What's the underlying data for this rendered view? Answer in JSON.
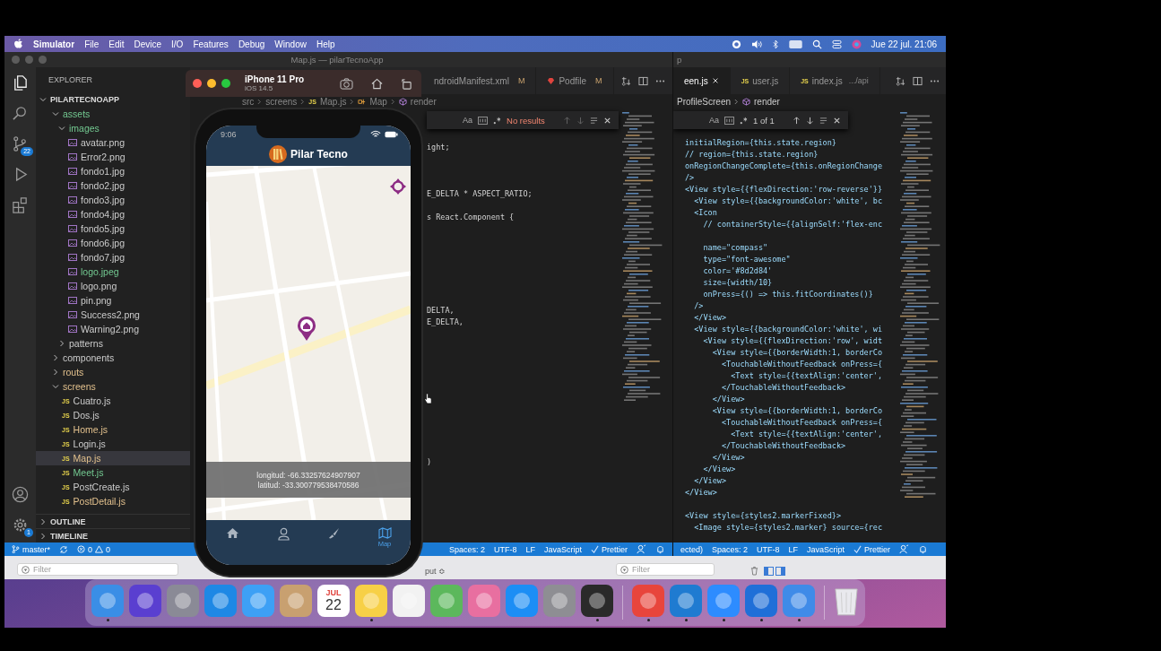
{
  "menu_bar": {
    "app_name": "Simulator",
    "items": [
      "File",
      "Edit",
      "Device",
      "I/O",
      "Features",
      "Debug",
      "Window",
      "Help"
    ],
    "clock": "Jue 22 jul. 21:06"
  },
  "vscode_main": {
    "title": "Map.js — pilarTecnoApp",
    "activity_bar": {
      "source_control_badge": "22",
      "settings_badge": "1"
    },
    "explorer": {
      "title": "EXPLORER",
      "root": "PILARTECNOAPP",
      "root_expanded": true,
      "tree": [
        {
          "label": "assets",
          "kind": "folder",
          "expanded": true,
          "untracked": true,
          "modified": false,
          "selected": false,
          "children": [
            {
              "label": "images",
              "kind": "folder",
              "expanded": true,
              "untracked": true,
              "modified": false,
              "selected": false,
              "children": [
                {
                  "label": "avatar.png",
                  "kind": "image",
                  "untracked": false,
                  "modified": false,
                  "selected": false
                },
                {
                  "label": "Error2.png",
                  "kind": "image",
                  "untracked": false,
                  "modified": false,
                  "selected": false
                },
                {
                  "label": "fondo1.jpg",
                  "kind": "image",
                  "untracked": false,
                  "modified": false,
                  "selected": false
                },
                {
                  "label": "fondo2.jpg",
                  "kind": "image",
                  "untracked": false,
                  "modified": false,
                  "selected": false
                },
                {
                  "label": "fondo3.jpg",
                  "kind": "image",
                  "untracked": false,
                  "modified": false,
                  "selected": false
                },
                {
                  "label": "fondo4.jpg",
                  "kind": "image",
                  "untracked": false,
                  "modified": false,
                  "selected": false
                },
                {
                  "label": "fondo5.jpg",
                  "kind": "image",
                  "untracked": false,
                  "modified": false,
                  "selected": false
                },
                {
                  "label": "fondo6.jpg",
                  "kind": "image",
                  "untracked": false,
                  "modified": false,
                  "selected": false
                },
                {
                  "label": "fondo7.jpg",
                  "kind": "image",
                  "untracked": false,
                  "modified": false,
                  "selected": false
                },
                {
                  "label": "logo.jpeg",
                  "kind": "image",
                  "untracked": true,
                  "modified": false,
                  "selected": false
                },
                {
                  "label": "logo.png",
                  "kind": "image",
                  "untracked": false,
                  "modified": false,
                  "selected": false
                },
                {
                  "label": "pin.png",
                  "kind": "image",
                  "untracked": false,
                  "modified": false,
                  "selected": false
                },
                {
                  "label": "Success2.png",
                  "kind": "image",
                  "untracked": false,
                  "modified": false,
                  "selected": false
                },
                {
                  "label": "Warning2.png",
                  "kind": "image",
                  "untracked": false,
                  "modified": false,
                  "selected": false
                }
              ]
            },
            {
              "label": "patterns",
              "kind": "folder",
              "expanded": false,
              "untracked": false,
              "modified": false,
              "selected": false
            }
          ]
        },
        {
          "label": "components",
          "kind": "folder",
          "expanded": false,
          "untracked": false,
          "modified": false,
          "selected": false
        },
        {
          "label": "routs",
          "kind": "folder",
          "expanded": false,
          "untracked": false,
          "modified": true,
          "selected": false
        },
        {
          "label": "screens",
          "kind": "folder",
          "expanded": true,
          "untracked": false,
          "modified": true,
          "selected": false,
          "children": [
            {
              "label": "Cuatro.js",
              "kind": "js",
              "icon_label": "JS",
              "untracked": false,
              "modified": false,
              "selected": false
            },
            {
              "label": "Dos.js",
              "kind": "js",
              "icon_label": "JS",
              "untracked": false,
              "modified": false,
              "selected": false
            },
            {
              "label": "Home.js",
              "kind": "js",
              "icon_label": "JS",
              "untracked": false,
              "modified": true,
              "selected": false
            },
            {
              "label": "Login.js",
              "kind": "js",
              "icon_label": "JS",
              "untracked": false,
              "modified": false,
              "selected": false
            },
            {
              "label": "Map.js",
              "kind": "js",
              "icon_label": "JS",
              "untracked": false,
              "modified": true,
              "selected": true
            },
            {
              "label": "Meet.js",
              "kind": "js",
              "icon_label": "JS",
              "untracked": true,
              "modified": false,
              "selected": false
            },
            {
              "label": "PostCreate.js",
              "kind": "js",
              "icon_label": "JS",
              "untracked": false,
              "modified": false,
              "selected": false
            },
            {
              "label": "PostDetail.js",
              "kind": "js",
              "icon_label": "JS",
              "untracked": false,
              "modified": true,
              "selected": false
            }
          ]
        }
      ],
      "sections": [
        {
          "label": "OUTLINE",
          "expanded": false
        },
        {
          "label": "TIMELINE",
          "expanded": false
        }
      ]
    },
    "tabs": [
      {
        "label": "ndroidManifest.xml",
        "badge": "M",
        "kind": "xml",
        "selected": false
      },
      {
        "label": "Podfile",
        "badge": "M",
        "kind": "ruby",
        "selected": false
      }
    ],
    "breadcrumb": [
      {
        "label": "src",
        "kind": "folder"
      },
      {
        "label": "screens",
        "kind": "folder"
      },
      {
        "label": "Map.js",
        "kind": "js",
        "icon_label": "JS"
      },
      {
        "label": "Map",
        "kind": "class"
      },
      {
        "label": "render",
        "kind": "method"
      }
    ],
    "find": {
      "case_label": "Aa",
      "result": "No results",
      "found": false
    },
    "code_lines": [
      "ight;",
      "E_DELTA * ASPECT_RATIO;",
      "s React.Component {",
      "DELTA,",
      "E_DELTA,",
      ")"
    ],
    "status_bar": {
      "branch": "master*",
      "errors": "0",
      "warnings": "0",
      "items": [
        "Spaces: 2",
        "UTF-8",
        "LF",
        "JavaScript",
        "Prettier"
      ]
    }
  },
  "vscode_side": {
    "title": "p",
    "tabs": [
      {
        "label": "een.js",
        "closable": true,
        "selected": true
      },
      {
        "label": "user.js",
        "icon_label": "JS",
        "selected": false
      },
      {
        "label": "index.js",
        "icon_label": "JS",
        "description": ".../api",
        "selected": false
      }
    ],
    "breadcrumb": [
      {
        "label": "ProfileScreen",
        "kind": "class"
      },
      {
        "label": "render",
        "kind": "method"
      }
    ],
    "find": {
      "case_label": "Aa",
      "result": "1 of 1",
      "found": true
    },
    "code_lines": [
      "initialRegion={this.state.region}",
      "// region={this.state.region}",
      "onRegionChangeComplete={this.onRegionChange",
      "/>",
      "<View style={{flexDirection:'row-reverse'}}",
      "  <View style={{backgroundColor:'white', bc",
      "  <Icon",
      "    // containerStyle={{alignSelf:'flex-enc",
      "    name=\"compass\"",
      "    type=\"font-awesome\"",
      "    color='#8d2d84'",
      "    size={width/10}",
      "    onPress={() => this.fitCoordinates()}",
      "  />",
      "  </View>",
      "  <View style={{backgroundColor:'white', wi",
      "    <View style={{flexDirection:'row', widt",
      "      <View style={{borderWidth:1, borderCo",
      "        <TouchableWithoutFeedback onPress={",
      "          <Text style={{textAlign:'center',",
      "        </TouchableWithoutFeedback>",
      "      </View>",
      "      <View style={{borderWidth:1, borderCo",
      "        <TouchableWithoutFeedback onPress={",
      "          <Text style={{textAlign:'center',",
      "        </TouchableWithoutFeedback>",
      "      </View>",
      "    </View>",
      "  </View>",
      "</View>",
      "<View style={styles2.markerFixed}>",
      "  <Image style={styles2.marker} source={rec"
    ],
    "status_bar": {
      "lead": "ected)",
      "items": [
        "Spaces: 2",
        "UTF-8",
        "LF",
        "JavaScript",
        "Prettier"
      ]
    }
  },
  "simulator": {
    "device": "iPhone 11 Pro",
    "os": "iOS 14.5",
    "phone": {
      "time": "9:06",
      "app_title": "Pilar Tecno",
      "coordinates": [
        "longitud: -66.33257624907907",
        "latitud: -33.300779538470586"
      ],
      "tabs": [
        {
          "kind": "home",
          "selected": false
        },
        {
          "kind": "profile",
          "selected": false
        },
        {
          "kind": "brush",
          "selected": false
        },
        {
          "kind": "map",
          "label": "Map",
          "selected": true
        }
      ]
    }
  },
  "debug_area": {
    "filter_left": "Filter",
    "output_menu": "put ≎",
    "filter_right": "Filter"
  },
  "dock": [
    {
      "kind": "app",
      "color": "#3a8ee6",
      "running": true
    },
    {
      "kind": "app",
      "color": "#5a3fd0",
      "running": false
    },
    {
      "kind": "app",
      "color": "#8a8a96",
      "running": false
    },
    {
      "kind": "app",
      "color": "#1e88e5",
      "running": false
    },
    {
      "kind": "app",
      "color": "#3da0f5",
      "running": false
    },
    {
      "kind": "app",
      "color": "#c8a070",
      "running": false
    },
    {
      "kind": "calendar",
      "month": "JUL",
      "day": "22",
      "running": false
    },
    {
      "kind": "app",
      "color": "#f7d046",
      "running": true
    },
    {
      "kind": "app",
      "color": "#f2f2f2",
      "running": false
    },
    {
      "kind": "app",
      "color": "#5cb85c",
      "running": false
    },
    {
      "kind": "app",
      "color": "#e86fa0",
      "running": false
    },
    {
      "kind": "app",
      "color": "#1c8ef5",
      "running": false
    },
    {
      "kind": "app",
      "color": "#8e8e93",
      "running": false
    },
    {
      "kind": "app",
      "color": "#2a2a2a",
      "running": true
    },
    {
      "kind": "separator"
    },
    {
      "kind": "app",
      "color": "#e8453c",
      "running": true
    },
    {
      "kind": "app",
      "color": "#1f7bd1",
      "running": true
    },
    {
      "kind": "app",
      "color": "#2d8cff",
      "running": true
    },
    {
      "kind": "app",
      "color": "#1f6fd8",
      "running": true
    },
    {
      "kind": "app",
      "color": "#3f8be8",
      "running": true
    },
    {
      "kind": "separator"
    },
    {
      "kind": "trash",
      "running": false
    }
  ]
}
